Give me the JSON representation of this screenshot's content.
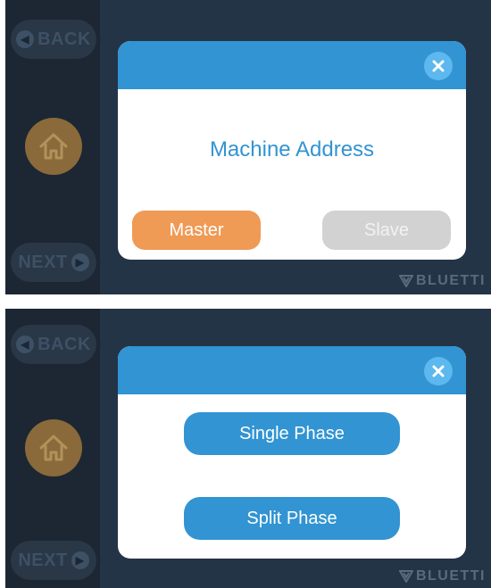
{
  "colors": {
    "background": "#243447",
    "sidebar": "#1c2733",
    "dialog_header": "#3294d2",
    "primary_blue": "#3294d2",
    "master_orange": "#ef9a55",
    "slave_gray": "#d2d2d2",
    "home_orange": "#8a6a3a"
  },
  "screen1": {
    "nav": {
      "back_label": "BACK",
      "next_label": "NEXT"
    },
    "logo": "BLUETTI",
    "dialog": {
      "title": "Machine Address",
      "buttons": [
        {
          "label": "Master",
          "state": "selected"
        },
        {
          "label": "Slave",
          "state": "unselected"
        }
      ]
    }
  },
  "screen2": {
    "nav": {
      "back_label": "BACK",
      "next_label": "NEXT"
    },
    "logo": "BLUETTI",
    "dialog": {
      "buttons": [
        {
          "label": "Single Phase"
        },
        {
          "label": "Split Phase"
        }
      ]
    }
  }
}
